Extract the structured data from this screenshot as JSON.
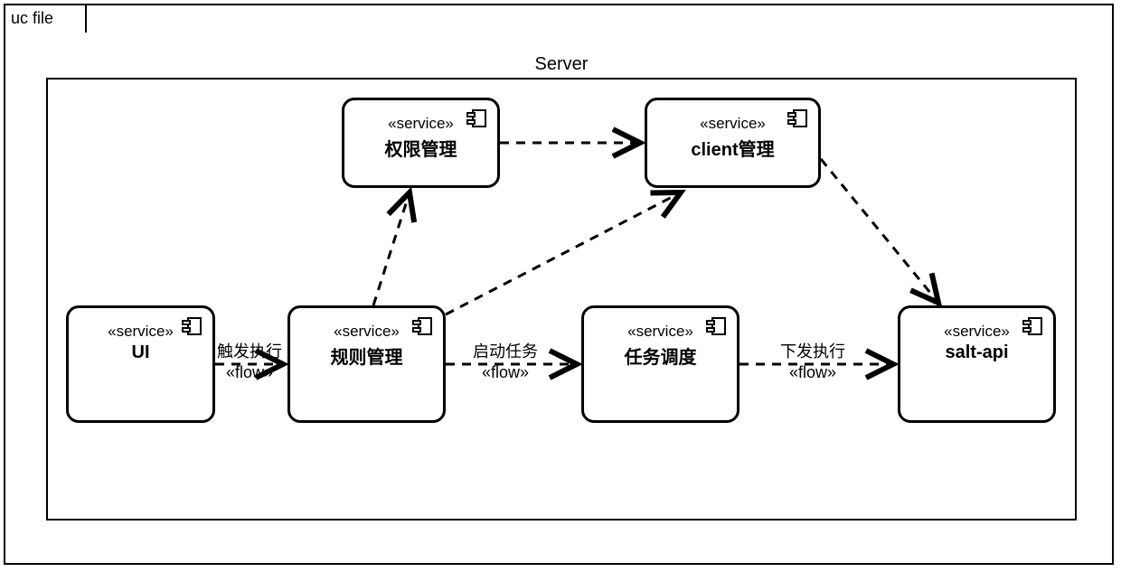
{
  "tab_label": "uc file",
  "container_title": "Server",
  "components": {
    "ui": {
      "stereo": "«service»",
      "name": "UI"
    },
    "rule": {
      "stereo": "«service»",
      "name": "规则管理"
    },
    "perm": {
      "stereo": "«service»",
      "name": "权限管理"
    },
    "client": {
      "stereo": "«service»",
      "name": "client管理"
    },
    "task": {
      "stereo": "«service»",
      "name": "任务调度"
    },
    "saltapi": {
      "stereo": "«service»",
      "name": "salt-api"
    }
  },
  "flows": {
    "ui_rule": {
      "label": "触发执行",
      "stereo": "«flow»"
    },
    "rule_task": {
      "label": "启动任务",
      "stereo": "«flow»"
    },
    "task_salt": {
      "label": "下发执行",
      "stereo": "«flow»"
    }
  }
}
